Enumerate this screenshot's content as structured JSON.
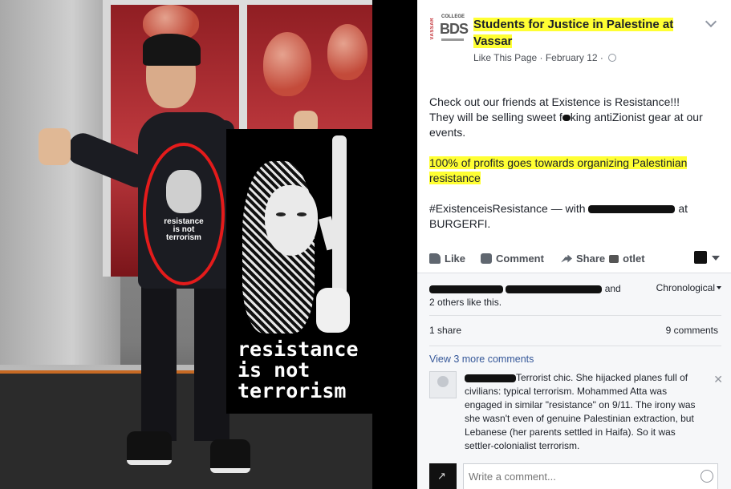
{
  "photo": {
    "shirt_text_lines": [
      "resistance",
      "is not",
      "terrorism"
    ],
    "zoom_text_lines": [
      "resistance",
      "is not",
      "terrorism"
    ],
    "highlight_color": "#e41b1b"
  },
  "post": {
    "page_name_line1": "Students for Justice in Palestine at",
    "page_name_line2": "Vassar",
    "logo": {
      "vertical_text": "VASSAR",
      "college_text": "COLLEGE",
      "bds_text": "BDS"
    },
    "like_page": "Like This Page",
    "date": "February 12",
    "body_p1_a": "Check out our friends at Existence is Resistance!!!",
    "body_p1_b": "They will be selling sweet f",
    "body_p1_c": "king antiZionist gear at our events.",
    "body_p2_line1": "100% of profits goes towards organizing Palestinian",
    "body_p2_line2": "resistance",
    "body_p3_a": "#ExistenceisResistance — with",
    "body_p3_b": "at",
    "body_p3_c": "BURGERFI.",
    "highlight_color": "#ffff33"
  },
  "actions": {
    "like": "Like",
    "comment": "Comment",
    "share": "Share",
    "share_suffix": "otlet"
  },
  "ufi": {
    "likes_and": "and",
    "likes_others": "2 others like this.",
    "order": "Chronological",
    "shares": "1 share",
    "comments_count": "9 comments",
    "view_more": "View 3 more comments",
    "comment_text": "Terrorist chic. She hijacked planes full of civilians: typical terrorism. Mohammed Atta was engaged in similar \"resistance\" on 9/11. The irony was she wasn't even of genuine Palestinian extraction, but Lebanese (her parents settled in Haifa). So it was settler-colonialist terrorism.",
    "write_placeholder": "Write a comment..."
  },
  "icons": [
    "globe-icon",
    "chevron-down-icon",
    "like-icon",
    "comment-icon",
    "share-icon",
    "close-icon",
    "emoji-icon"
  ]
}
